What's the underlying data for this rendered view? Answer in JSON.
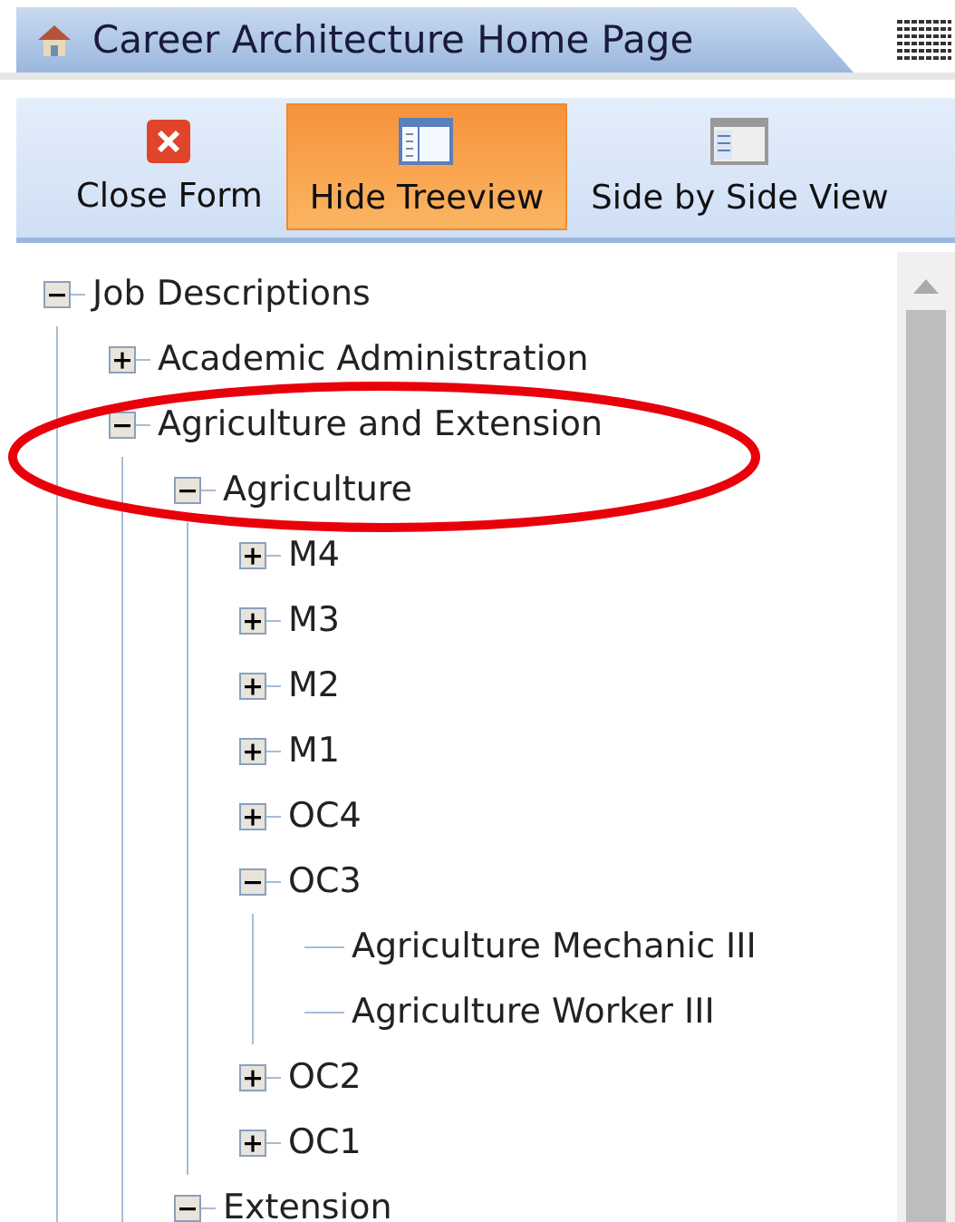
{
  "tab": {
    "title": "Career Architecture Home Page"
  },
  "toolbar": [
    {
      "kind": "close",
      "label": "Close Form",
      "selected": false
    },
    {
      "kind": "hide",
      "label": "Hide Treeview",
      "selected": true
    },
    {
      "kind": "side",
      "label": "Side by Side View",
      "selected": false
    }
  ],
  "tree": [
    {
      "label": "Job Descriptions",
      "expanded": true,
      "children": [
        {
          "label": "Academic Administration",
          "expanded": false
        },
        {
          "label": "Agriculture and Extension",
          "expanded": true,
          "children": [
            {
              "label": "Agriculture",
              "expanded": true,
              "children": [
                {
                  "label": "M4",
                  "expanded": false
                },
                {
                  "label": "M3",
                  "expanded": false
                },
                {
                  "label": "M2",
                  "expanded": false
                },
                {
                  "label": "M1",
                  "expanded": false
                },
                {
                  "label": "OC4",
                  "expanded": false
                },
                {
                  "label": "OC3",
                  "expanded": true,
                  "children": [
                    {
                      "label": "Agriculture Mechanic III"
                    },
                    {
                      "label": "Agriculture Worker III"
                    }
                  ]
                },
                {
                  "label": "OC2",
                  "expanded": false
                },
                {
                  "label": "OC1",
                  "expanded": false
                }
              ]
            },
            {
              "label": "Extension",
              "expanded": true
            }
          ]
        }
      ]
    }
  ]
}
